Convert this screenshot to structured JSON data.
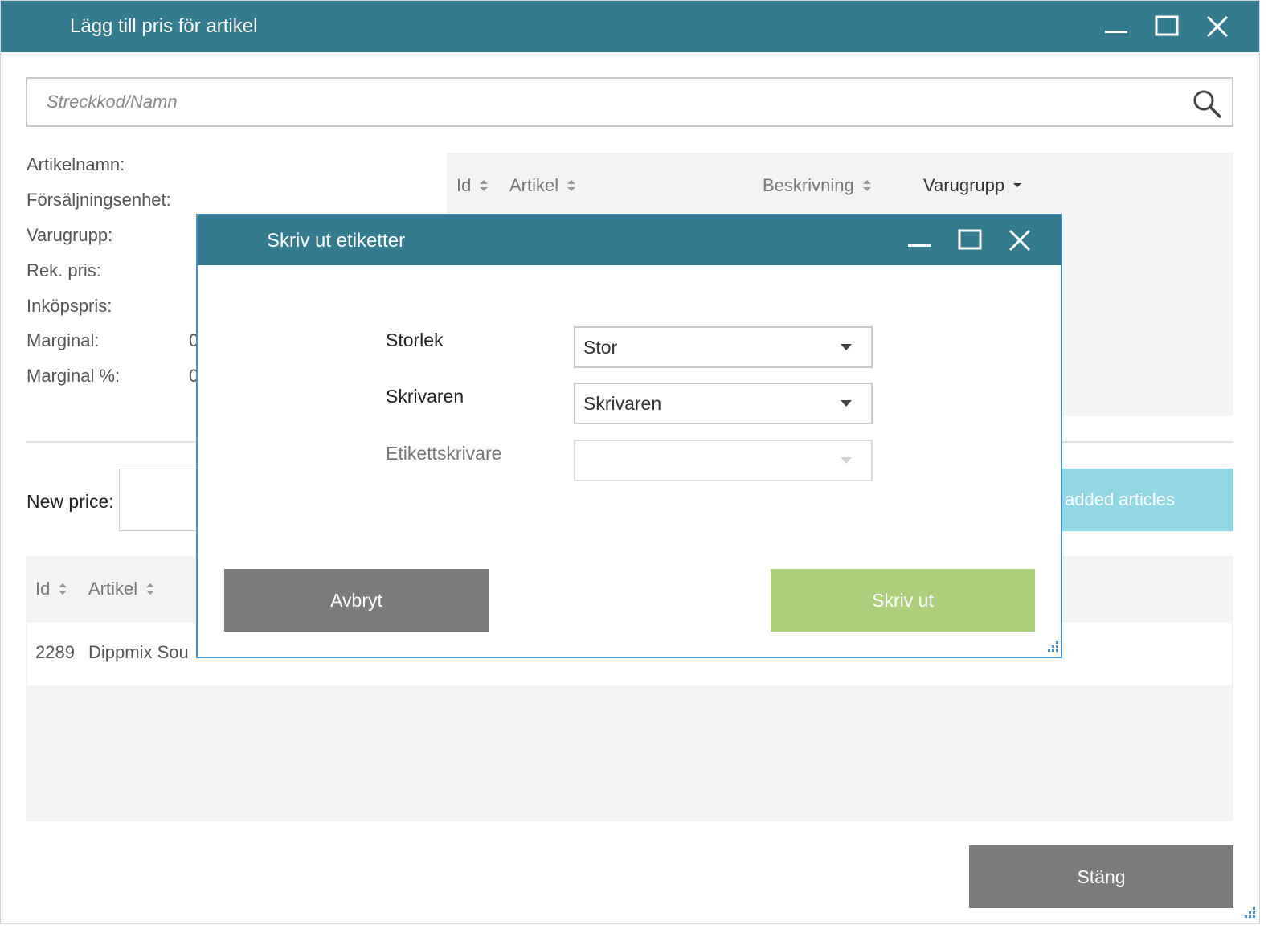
{
  "window": {
    "title": "Lägg till pris för artikel"
  },
  "search": {
    "placeholder": "Streckkod/Namn"
  },
  "info": {
    "labels": [
      "Artikelnamn:",
      "Försäljningsenhet:",
      "Varugrupp:",
      "Rek. pris:",
      "Inköpspris:",
      "Marginal:",
      "Marginal %:"
    ],
    "marginal_value": "0",
    "marginal_pct_value": "0"
  },
  "upper_table": {
    "headers": [
      "Id",
      "Artikel",
      "Beskrivning",
      "Varugrupp"
    ]
  },
  "new_price": {
    "label": "New price:",
    "value": ""
  },
  "added_articles_button": "added articles",
  "lower_table": {
    "headers": [
      "Id",
      "Artikel"
    ],
    "rows": [
      {
        "id": "2289",
        "artikel": "Dippmix Sou"
      }
    ]
  },
  "close_button": "Stäng",
  "dialog": {
    "title": "Skriv ut etiketter",
    "fields": [
      {
        "label": "Storlek",
        "value": "Stor"
      },
      {
        "label": "Skrivaren",
        "value": "Skrivaren"
      },
      {
        "label": "Etikettskrivare",
        "value": ""
      }
    ],
    "cancel_label": "Avbryt",
    "print_label": "Skriv ut"
  },
  "colors": {
    "titlebar": "#357b8e",
    "primary_button": "#aed07d",
    "secondary_button": "#7b7c7e",
    "info_button": "#93d7e4",
    "dialog_border": "#4a90c2"
  }
}
